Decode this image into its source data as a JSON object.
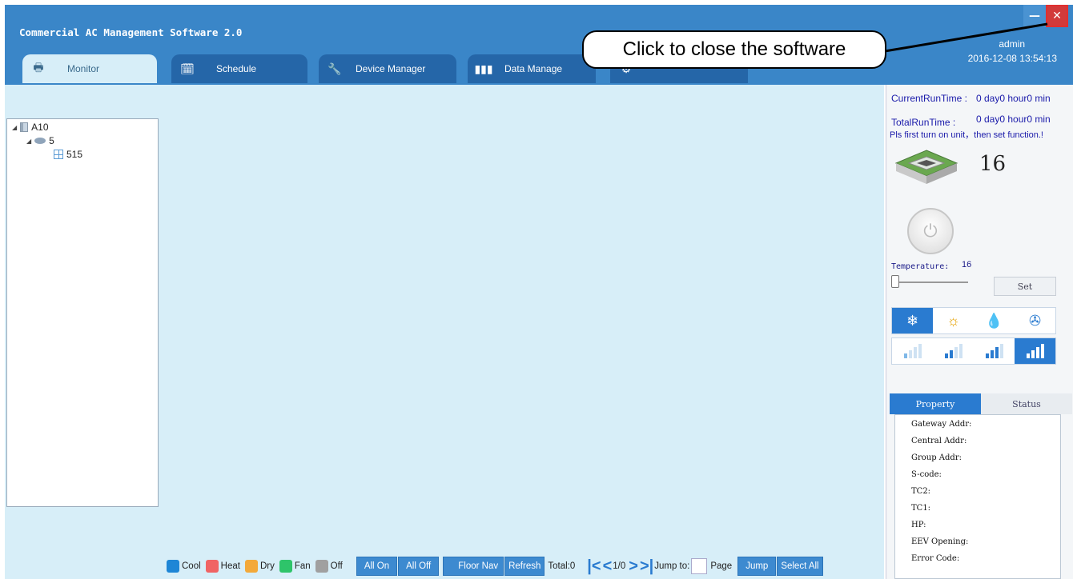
{
  "app": {
    "title": "Commercial AC Management Software 2.0",
    "minimize_glyph": "—",
    "close_glyph": "✕"
  },
  "tabs": [
    {
      "label": "Monitor",
      "icon": "monitor-icon"
    },
    {
      "label": "Schedule",
      "icon": "calendar-icon"
    },
    {
      "label": "Device Manager",
      "icon": "wrench-icon"
    },
    {
      "label": "Data Manage",
      "icon": "bar-chart-icon"
    },
    {
      "label": "",
      "icon": "gear-icon"
    }
  ],
  "user": {
    "name": "admin",
    "datetime": "2016-12-08 13:54:13"
  },
  "callout": {
    "text": "Click to close the software"
  },
  "tree": [
    {
      "label": "A10",
      "level": 0,
      "icon": "building-icon"
    },
    {
      "label": "5",
      "level": 1,
      "icon": "floor-icon"
    },
    {
      "label": "515",
      "level": 2,
      "icon": "unit-grid-icon"
    }
  ],
  "legend": [
    {
      "label": "Cool",
      "color": "#1e86d6"
    },
    {
      "label": "Heat",
      "color": "#f06464"
    },
    {
      "label": "Dry",
      "color": "#f3a93a"
    },
    {
      "label": "Fan",
      "color": "#2ec46a"
    },
    {
      "label": "Off",
      "color": "#a0a0a0"
    }
  ],
  "bottom": {
    "all_on": "All On",
    "all_off": "All Off",
    "floor_nav": "Floor Nav",
    "refresh": "Refresh",
    "total": "Total:0",
    "page_info": "1/0",
    "jump_to": "Jump to:",
    "page": "Page",
    "jump": "Jump",
    "select_all": "Select All"
  },
  "status": {
    "current_run_label": "CurrentRunTime :",
    "current_run_value": "0 day0 hour0 min",
    "total_run_label": "TotalRunTime :",
    "total_run_value": "0 day0 hour0 min",
    "hint": "Pls first turn on unit，then set function.!",
    "unit_number": "16",
    "temperature_label": "Temperature:",
    "temperature_value": "16",
    "set_label": "Set",
    "selected_mode": "cool",
    "selected_fan": 4
  },
  "property": {
    "tab_property": "Property",
    "tab_status": "Status",
    "rows": [
      "Gateway Addr:",
      "Central Addr:",
      "Group Addr:",
      "S-code:",
      "TC2:",
      "TC1:",
      "HP:",
      "EEV Opening:",
      "Error Code:"
    ]
  }
}
